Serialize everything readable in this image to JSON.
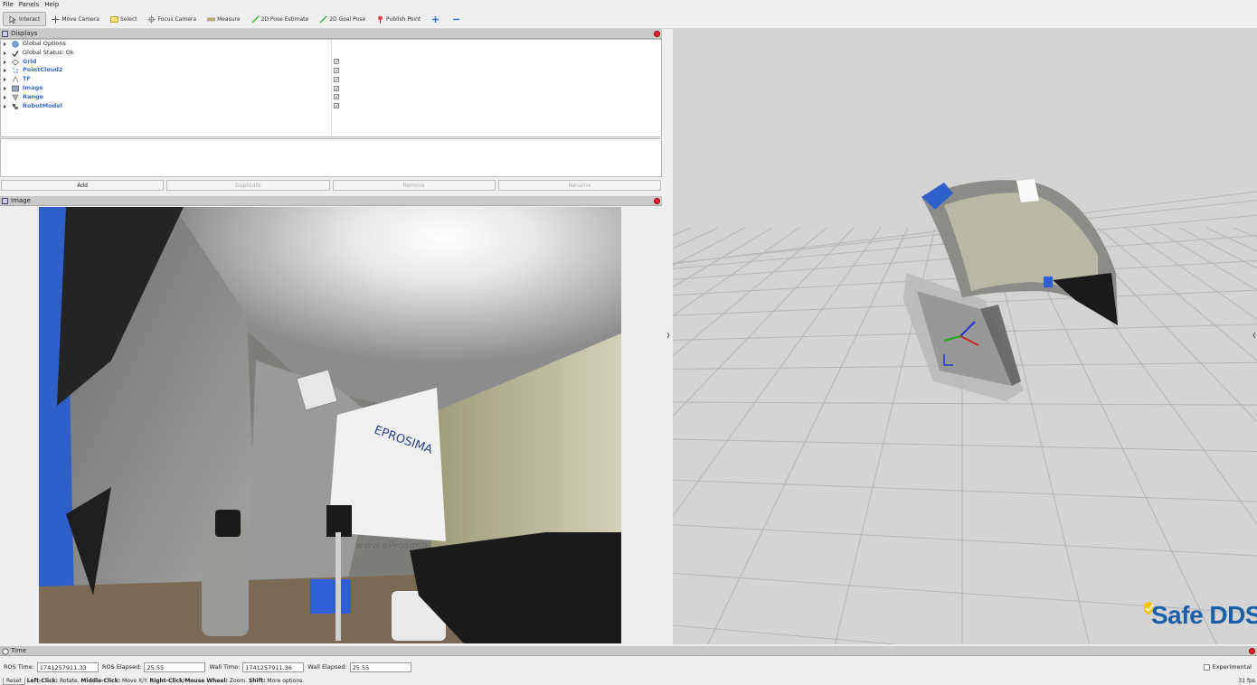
{
  "menu": [
    "File",
    "Panels",
    "Help"
  ],
  "toolbar": {
    "tools": [
      {
        "label": "Interact",
        "icon": "cursor-icon"
      },
      {
        "label": "Move Camera",
        "icon": "move-icon"
      },
      {
        "label": "Select",
        "icon": "select-box-icon"
      },
      {
        "label": "Focus Camera",
        "icon": "crosshair-icon"
      },
      {
        "label": "Measure",
        "icon": "ruler-icon"
      },
      {
        "label": "2D Pose Estimate",
        "icon": "green-arrow-icon"
      },
      {
        "label": "2D Goal Pose",
        "icon": "green-arrow-icon"
      },
      {
        "label": "Publish Point",
        "icon": "pin-icon"
      }
    ]
  },
  "displays_panel": {
    "title": "Displays",
    "items": [
      {
        "label": "Global Options",
        "icon": "globe-icon",
        "style": "normal",
        "checked": null
      },
      {
        "label": "Global Status: Ok",
        "icon": "check-icon",
        "style": "normal",
        "checked": null
      },
      {
        "label": "Grid",
        "icon": "grid-icon",
        "style": "blue",
        "checked": true
      },
      {
        "label": "PointCloud2",
        "icon": "pointcloud-icon",
        "style": "blue",
        "checked": true
      },
      {
        "label": "TF",
        "icon": "tf-icon",
        "style": "blue",
        "checked": true
      },
      {
        "label": "Image",
        "icon": "image-icon",
        "style": "blue",
        "checked": true
      },
      {
        "label": "Range",
        "icon": "range-icon",
        "style": "blue",
        "checked": true
      },
      {
        "label": "RobotModel",
        "icon": "robot-icon",
        "style": "blue",
        "checked": true
      }
    ],
    "buttons": {
      "add": "Add",
      "duplicate": "Duplicate",
      "remove": "Remove",
      "rename": "Rename"
    }
  },
  "image_panel": {
    "title": "Image"
  },
  "camera_image": {
    "poster_text": "EPROSIMA",
    "poster_url": "www.eProsima"
  },
  "brand": {
    "logo_text": "Safe DDS"
  },
  "time_panel": {
    "title": "Time",
    "ros_time_label": "ROS Time:",
    "ros_time": "1741257911.33",
    "ros_elapsed_label": "ROS Elapsed:",
    "ros_elapsed": "25.55",
    "wall_time_label": "Wall Time:",
    "wall_time": "1741257911.36",
    "wall_elapsed_label": "Wall Elapsed:",
    "wall_elapsed": "25.55",
    "experimental": "Experimental"
  },
  "statusbar": {
    "reset": "Reset",
    "left_key": "Left-Click:",
    "left_val": "Rotate.",
    "middle_key": "Middle-Click:",
    "middle_val": "Move X/Y.",
    "right_key": "Right-Click/Mouse Wheel:",
    "right_val": "Zoom.",
    "shift_key": "Shift:",
    "shift_val": "More options.",
    "fps": "31 fps"
  },
  "colors": {
    "accent_blue": "#3a6bd0",
    "close_red": "#e22233",
    "logo_blue": "#1b5fa8",
    "logo_yellow": "#f5c400"
  }
}
